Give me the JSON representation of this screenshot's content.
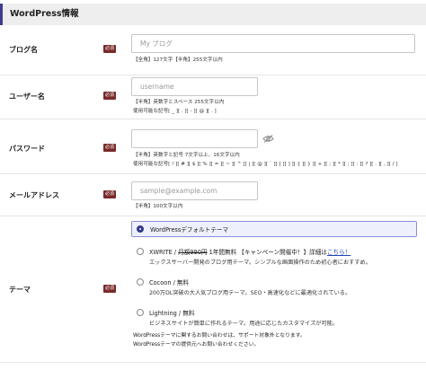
{
  "section_title": "WordPress情報",
  "required_badge": "必須",
  "fields": {
    "blog_name": {
      "label": "ブログ名",
      "placeholder": "My ブログ",
      "help": "【全角】127文字【半角】255文字以内"
    },
    "username": {
      "label": "ユーザー名",
      "placeholder": "username",
      "help1": "【半角】英数字とスペース 255文字以内",
      "help2": "使用可能な記号[ _ ][ . ][ - ][ @ ][ . ]"
    },
    "password": {
      "label": "パスワード",
      "placeholder": "",
      "help1": "【半角】英数字と記号 7文字以上、16文字以内",
      "help2": "使用可能な記号[ ! ][ # ][ $ ][ % ][ = ][ ~ ][ ^ ][ | ][ @ ][ ` ][ [ ][ ] ][ { ][ } ][ + ][ ; ][ * ][ ; ][ : ][ ? ][ . ][ , ][ / ]"
    },
    "email": {
      "label": "メールアドレス",
      "placeholder": "sample@example.com",
      "help": "【半角】100文字以内"
    }
  },
  "theme": {
    "label": "テーマ",
    "options": [
      {
        "name": "WordPressデフォルトテーマ",
        "selected": true
      },
      {
        "name_prefix": "XWRITE / ",
        "price_old": "月額990円",
        "name_suffix": " 1年間無料 【キャンペーン開催中！】詳細は",
        "link": "こちら！",
        "desc": "エックスサーバー開発のブログ用テーマ。シンプルな画面操作のため初心者におすすめ。",
        "selected": false
      },
      {
        "name": "Cocoon / 無料",
        "desc": "200万DL突破の大人気ブログ用テーマ。SEO・高速化などに最適化されている。",
        "selected": false
      },
      {
        "name": "Lightning / 無料",
        "desc": "ビジネスサイトが簡単に作れるテーマ。用途に応じたカスタマイズが可能。",
        "selected": false
      }
    ],
    "note1": "WordPressテーマに関するお問い合わせは、サポート対象外となります。",
    "note2": "WordPressテーマの提供元へお問い合わせください。"
  },
  "colors": {
    "accent": "#3d3d8f",
    "badge": "#7a2a2a",
    "link": "#2045b8",
    "selected_bg": "#eef0fb"
  },
  "icons": {
    "password_toggle": "eye-slash-icon"
  }
}
